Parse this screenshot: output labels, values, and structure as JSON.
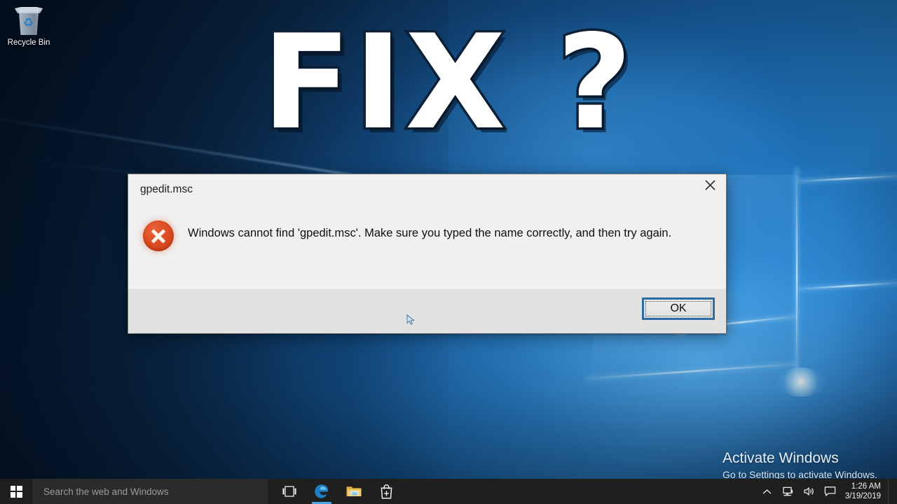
{
  "desktop": {
    "recycle_bin": {
      "label": "Recycle Bin",
      "icon": "recycle-bin-icon"
    },
    "overlay_text": "FIX ?",
    "activation": {
      "title": "Activate Windows",
      "subtitle": "Go to Settings to activate Windows."
    },
    "cursor": "mouse-pointer-icon"
  },
  "dialog": {
    "title": "gpedit.msc",
    "close_icon": "close-icon",
    "error_icon": "error-circle-icon",
    "message": "Windows cannot find 'gpedit.msc'. Make sure you typed the name correctly, and then try again.",
    "ok_label": "OK",
    "colors": {
      "background": "#f0f0f0",
      "footer": "#e2e2e2",
      "border": "#6e7277",
      "error_red": "#de4f24",
      "focus_blue": "#2d6ba3"
    }
  },
  "taskbar": {
    "start": {
      "icon": "windows-start-icon",
      "label": "Start"
    },
    "search": {
      "placeholder": "Search the web and Windows",
      "value": ""
    },
    "buttons": [
      {
        "name": "task-view-button",
        "icon": "task-view-icon",
        "label": "Task View",
        "running": false
      },
      {
        "name": "edge-button",
        "icon": "edge-browser-icon",
        "label": "Microsoft Edge",
        "running": true
      },
      {
        "name": "file-explorer-button",
        "icon": "file-explorer-icon",
        "label": "File Explorer",
        "running": false
      },
      {
        "name": "store-button",
        "icon": "microsoft-store-icon",
        "label": "Store",
        "running": false
      }
    ],
    "tray": [
      {
        "name": "tray-show-hidden-icons",
        "icon": "chevron-up-icon",
        "label": "Show hidden icons"
      },
      {
        "name": "tray-network",
        "icon": "network-icon",
        "label": "Network"
      },
      {
        "name": "tray-volume",
        "icon": "speaker-icon",
        "label": "Volume"
      },
      {
        "name": "tray-action-center",
        "icon": "action-center-icon",
        "label": "Action Center"
      }
    ],
    "clock": {
      "time": "1:26 AM",
      "date": "3/19/2019"
    },
    "colors": {
      "background": "#1f1f1f",
      "search_background": "#2b2b2b",
      "accent": "#4aa8e8"
    }
  }
}
